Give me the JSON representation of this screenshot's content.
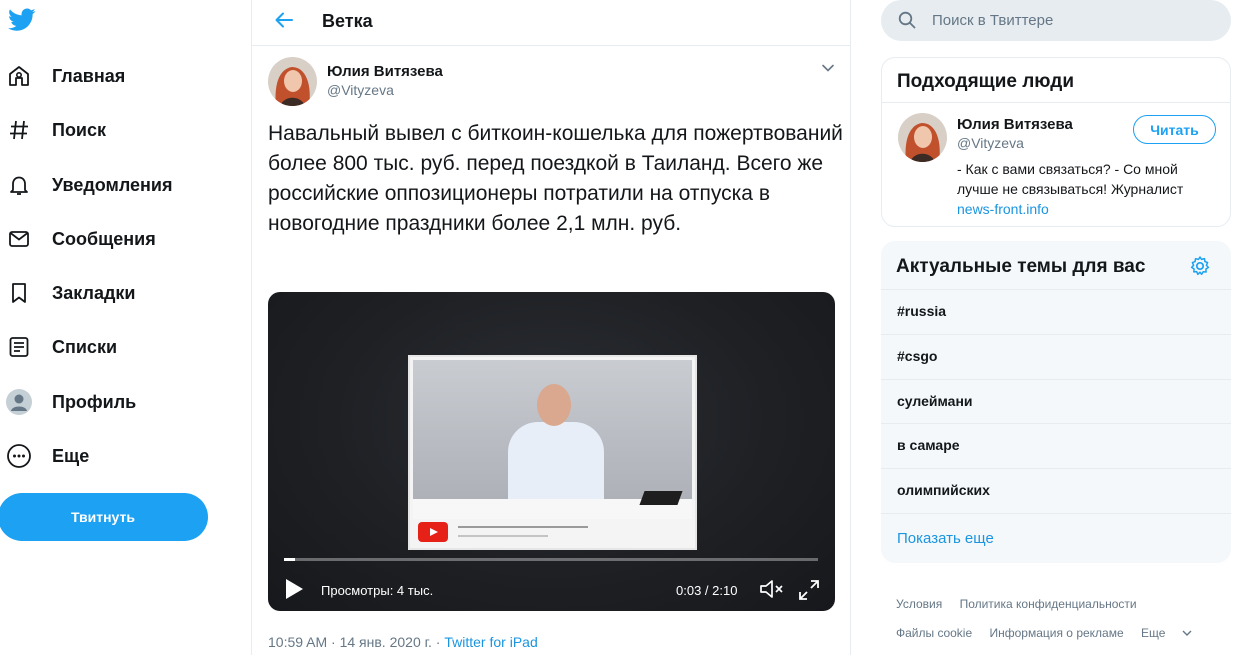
{
  "nav": {
    "items": [
      {
        "label": "Главная",
        "icon": "home-icon"
      },
      {
        "label": "Поиск",
        "icon": "hashtag-icon"
      },
      {
        "label": "Уведомления",
        "icon": "bell-icon"
      },
      {
        "label": "Сообщения",
        "icon": "envelope-icon"
      },
      {
        "label": "Закладки",
        "icon": "bookmark-icon"
      },
      {
        "label": "Списки",
        "icon": "list-icon"
      },
      {
        "label": "Профиль",
        "icon": "profile-icon"
      },
      {
        "label": "Еще",
        "icon": "more-icon"
      }
    ],
    "tweet_button": "Твитнуть"
  },
  "header": {
    "title": "Ветка"
  },
  "tweet": {
    "author_name": "Юлия Витязева",
    "author_handle": "@Vityzeva",
    "text": "Навальный вывел с биткоин-кошелька для пожертвований более 800 тыс. руб. перед поездкой в Таиланд. Всего же российские оппозиционеры потратили на отпуска в новогодние праздники более 2,1 млн. руб.",
    "video": {
      "views": "Просмотры: 4 тыс.",
      "time": "0:03 / 2:10",
      "progress": 0.02
    },
    "timestamp": "10:59 AM · 14 янв. 2020 г. · ",
    "source": "Twitter for iPad"
  },
  "search": {
    "placeholder": "Поиск в Твиттере"
  },
  "who_to_follow": {
    "title": "Подходящие люди",
    "user": {
      "name": "Юлия Витязева",
      "handle": "@Vityzeva",
      "follow_label": "Читать",
      "bio": "- Как с вами связаться? - Со мной лучше не связываться! Журналист",
      "bio_link": "news-front.info"
    }
  },
  "trends": {
    "title": "Актуальные темы для вас",
    "items": [
      "#russia",
      "#csgo",
      "сулеймани",
      "в самаре",
      "олимпийских"
    ],
    "show_more": "Показать еще"
  },
  "footer": {
    "row1": [
      "Условия",
      "Политика конфиденциальности"
    ],
    "row2": [
      "Файлы cookie",
      "Информация о рекламе",
      "Еще"
    ]
  },
  "colors": {
    "accent": "#1da1f2",
    "link": "#1b95e0",
    "secondary_text": "#657786"
  }
}
